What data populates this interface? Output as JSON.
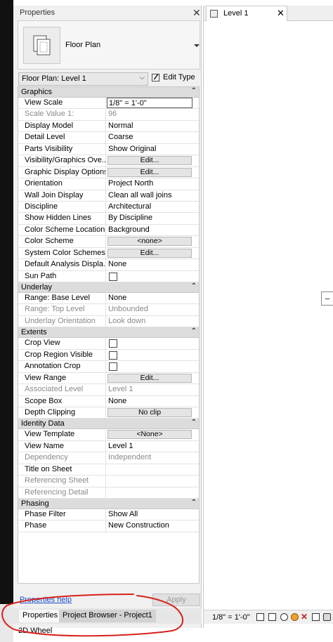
{
  "properties_panel": {
    "title": "Properties",
    "close_glyph": "✕",
    "type_selector": {
      "type_name": "Floor Plan",
      "icon": "floor-plan-icon"
    },
    "instance_selector": {
      "value": "Floor Plan: Level 1",
      "chevron": "⌵"
    },
    "edit_type_label": "Edit Type",
    "groups": [
      {
        "label": "Graphics",
        "collapse_glyph": "⌃",
        "rows": [
          {
            "name": "View Scale",
            "value": "1/8\" = 1'-0\"",
            "kind": "edit"
          },
          {
            "name": "Scale Value    1:",
            "value": "96",
            "kind": "text",
            "dim": true
          },
          {
            "name": "Display Model",
            "value": "Normal",
            "kind": "text"
          },
          {
            "name": "Detail Level",
            "value": "Coarse",
            "kind": "text"
          },
          {
            "name": "Parts Visibility",
            "value": "Show Original",
            "kind": "text"
          },
          {
            "name": "Visibility/Graphics Ove...",
            "value": "Edit...",
            "kind": "button"
          },
          {
            "name": "Graphic Display Options",
            "value": "Edit...",
            "kind": "button"
          },
          {
            "name": "Orientation",
            "value": "Project North",
            "kind": "text"
          },
          {
            "name": "Wall Join Display",
            "value": "Clean all wall joins",
            "kind": "text"
          },
          {
            "name": "Discipline",
            "value": "Architectural",
            "kind": "text"
          },
          {
            "name": "Show Hidden Lines",
            "value": "By Discipline",
            "kind": "text"
          },
          {
            "name": "Color Scheme Location",
            "value": "Background",
            "kind": "text"
          },
          {
            "name": "Color Scheme",
            "value": "<none>",
            "kind": "button"
          },
          {
            "name": "System Color Schemes",
            "value": "Edit...",
            "kind": "button"
          },
          {
            "name": "Default Analysis Displa...",
            "value": "None",
            "kind": "text"
          },
          {
            "name": "Sun Path",
            "value": "",
            "kind": "checkbox",
            "checked": false
          }
        ]
      },
      {
        "label": "Underlay",
        "collapse_glyph": "⌃",
        "rows": [
          {
            "name": "Range: Base Level",
            "value": "None",
            "kind": "text"
          },
          {
            "name": "Range: Top Level",
            "value": "Unbounded",
            "kind": "text",
            "dim": true
          },
          {
            "name": "Underlay Orientation",
            "value": "Look down",
            "kind": "text",
            "dim": true
          }
        ]
      },
      {
        "label": "Extents",
        "collapse_glyph": "⌃",
        "rows": [
          {
            "name": "Crop View",
            "value": "",
            "kind": "checkbox",
            "checked": false
          },
          {
            "name": "Crop Region Visible",
            "value": "",
            "kind": "checkbox",
            "checked": false
          },
          {
            "name": "Annotation Crop",
            "value": "",
            "kind": "checkbox",
            "checked": false
          },
          {
            "name": "View Range",
            "value": "Edit...",
            "kind": "button"
          },
          {
            "name": "Associated Level",
            "value": "Level 1",
            "kind": "text",
            "dim": true
          },
          {
            "name": "Scope Box",
            "value": "None",
            "kind": "text"
          },
          {
            "name": "Depth Clipping",
            "value": "No clip",
            "kind": "button"
          }
        ]
      },
      {
        "label": "Identity Data",
        "collapse_glyph": "⌃",
        "rows": [
          {
            "name": "View Template",
            "value": "<None>",
            "kind": "button"
          },
          {
            "name": "View Name",
            "value": "Level 1",
            "kind": "text"
          },
          {
            "name": "Dependency",
            "value": "Independent",
            "kind": "text",
            "dim": true
          },
          {
            "name": "Title on Sheet",
            "value": "",
            "kind": "text"
          },
          {
            "name": "Referencing Sheet",
            "value": "",
            "kind": "text",
            "dim": true
          },
          {
            "name": "Referencing Detail",
            "value": "",
            "kind": "text",
            "dim": true
          }
        ]
      },
      {
        "label": "Phasing",
        "collapse_glyph": "⌃",
        "rows": [
          {
            "name": "Phase Filter",
            "value": "Show All",
            "kind": "text"
          },
          {
            "name": "Phase",
            "value": "New Construction",
            "kind": "text"
          }
        ]
      }
    ],
    "help_link": "Properties help",
    "apply_label": "Apply"
  },
  "bottom_tabs": {
    "active": "Properties",
    "inactive": "Project Browser - Project1"
  },
  "status_bar": {
    "left_text": "2D Wheel",
    "scale": "1/8\" = 1'-0\""
  },
  "view_tab": {
    "label": "Level 1",
    "close_glyph": "✕"
  },
  "colors": {
    "annotation_red": "#d8211c",
    "link_blue": "#1a4fc9"
  }
}
